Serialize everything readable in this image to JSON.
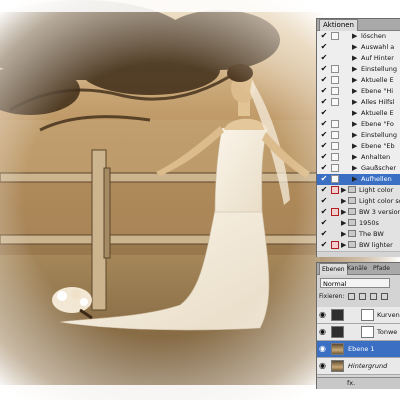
{
  "actions_panel": {
    "tab_label": "Aktionen",
    "rows": [
      {
        "label": "löschen",
        "check": "✔",
        "dialog": "box",
        "kind": "step"
      },
      {
        "label": "Auswahl a",
        "check": "✔",
        "dialog": "none",
        "kind": "step"
      },
      {
        "label": "Auf Hinter",
        "check": "✔",
        "dialog": "none",
        "kind": "step"
      },
      {
        "label": "Einstellung",
        "check": "✔",
        "dialog": "box",
        "kind": "step"
      },
      {
        "label": "Aktuelle E",
        "check": "✔",
        "dialog": "box",
        "kind": "step"
      },
      {
        "label": "Ebene \"Hi",
        "check": "✔",
        "dialog": "box",
        "kind": "step"
      },
      {
        "label": "Alles Hilfsl",
        "check": "✔",
        "dialog": "box",
        "kind": "step"
      },
      {
        "label": "Aktuelle E",
        "check": "✔",
        "dialog": "none",
        "kind": "step"
      },
      {
        "label": "Ebene \"Fo",
        "check": "✔",
        "dialog": "box",
        "kind": "step"
      },
      {
        "label": "Einstellung",
        "check": "✔",
        "dialog": "box",
        "kind": "step"
      },
      {
        "label": "Ebene \"Eb",
        "check": "✔",
        "dialog": "box",
        "kind": "step"
      },
      {
        "label": "Anhalten",
        "check": "✔",
        "dialog": "box",
        "kind": "step"
      },
      {
        "label": "Gaußscher",
        "check": "✔",
        "dialog": "box",
        "kind": "step"
      },
      {
        "label": "Aufhellen",
        "check": "✔",
        "dialog": "box",
        "kind": "selected"
      },
      {
        "label": "Light color",
        "check": "✔",
        "dialog": "red",
        "kind": "set"
      },
      {
        "label": "Light color soft",
        "check": "✔",
        "dialog": "none",
        "kind": "set"
      },
      {
        "label": "BW 3 versions",
        "check": "✔",
        "dialog": "red",
        "kind": "set"
      },
      {
        "label": "1950s",
        "check": "✔",
        "dialog": "none",
        "kind": "set"
      },
      {
        "label": "The BW",
        "check": "✔",
        "dialog": "none",
        "kind": "set"
      },
      {
        "label": "BW lighter",
        "check": "✔",
        "dialog": "red",
        "kind": "set"
      }
    ]
  },
  "layers_panel": {
    "tabs": [
      "Ebenen",
      "Kanäle",
      "Pfade"
    ],
    "blend_mode": "Normal",
    "lock_label": "Fixieren:",
    "layers": [
      {
        "name": "Kurven",
        "thumb": "adj",
        "selected": false,
        "italic": false
      },
      {
        "name": "Tonwe",
        "thumb": "adj",
        "selected": false,
        "italic": false
      },
      {
        "name": "Ebene 1",
        "thumb": "photo",
        "selected": true,
        "italic": false
      },
      {
        "name": "Hintergrund",
        "thumb": "photo",
        "selected": false,
        "italic": true
      }
    ],
    "footer_label": "fx."
  },
  "icons": {
    "visibility": "eye-icon",
    "check": "checkmark-icon",
    "expand": "triangle-right-icon"
  }
}
